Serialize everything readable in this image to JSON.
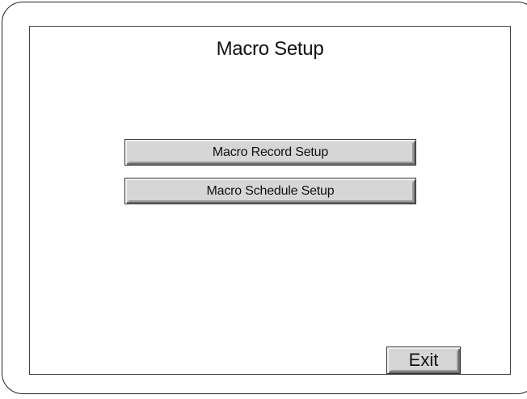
{
  "screen": {
    "title": "Macro Setup"
  },
  "menu": {
    "items": [
      {
        "label": "Macro Record Setup"
      },
      {
        "label": "Macro Schedule Setup"
      }
    ]
  },
  "footer": {
    "exit_label": "Exit"
  },
  "colors": {
    "button_face": "#d6d6d6",
    "frame": "#222222",
    "background": "#ffffff"
  }
}
